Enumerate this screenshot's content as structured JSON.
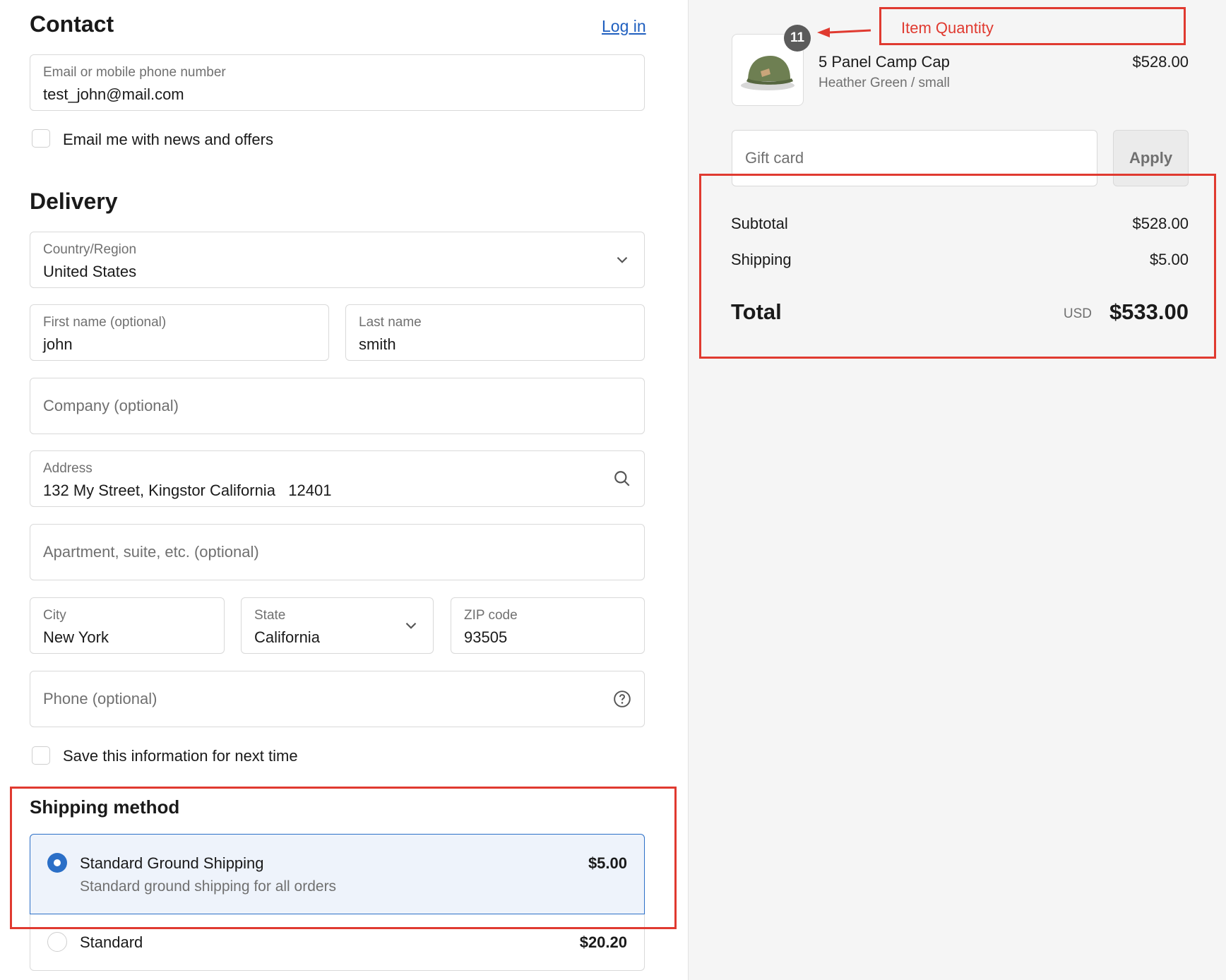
{
  "contact": {
    "heading": "Contact",
    "login_link": "Log in",
    "email_label": "Email or mobile phone number",
    "email_value": "test_john@mail.com",
    "news_checkbox_label": "Email me with news and offers"
  },
  "delivery": {
    "heading": "Delivery",
    "country_label": "Country/Region",
    "country_value": "United States",
    "first_name_label": "First name (optional)",
    "first_name_value": "john",
    "last_name_label": "Last name",
    "last_name_value": "smith",
    "company_placeholder": "Company (optional)",
    "address_label": "Address",
    "address_value": "132 My Street, Kingstor California   12401",
    "apartment_placeholder": "Apartment, suite, etc. (optional)",
    "city_label": "City",
    "city_value": "New York",
    "state_label": "State",
    "state_value": "California",
    "zip_label": "ZIP code",
    "zip_value": "93505",
    "phone_placeholder": "Phone (optional)",
    "save_info_label": "Save this information for next time"
  },
  "shipping_method": {
    "heading": "Shipping method",
    "options": [
      {
        "name": "Standard Ground Shipping",
        "description": "Standard ground shipping for all orders",
        "price": "$5.00",
        "selected": true
      },
      {
        "name": "Standard",
        "description": "",
        "price": "$20.20",
        "selected": false
      }
    ]
  },
  "summary": {
    "item": {
      "quantity_badge": "11",
      "name": "5 Panel Camp Cap",
      "variant": "Heather Green / small",
      "price": "$528.00"
    },
    "gift_card_placeholder": "Gift card",
    "apply_label": "Apply",
    "subtotal_label": "Subtotal",
    "subtotal_value": "$528.00",
    "shipping_label": "Shipping",
    "shipping_value": "$5.00",
    "total_label": "Total",
    "total_currency": "USD",
    "total_value": "$533.00"
  },
  "annotations": {
    "item_quantity_label": "Item Quantity",
    "color": "#e03a30"
  },
  "colors": {
    "accent": "#2b6fc7",
    "link": "#1f5fbf",
    "muted": "#707070",
    "sidebar_bg": "#f5f5f5"
  }
}
